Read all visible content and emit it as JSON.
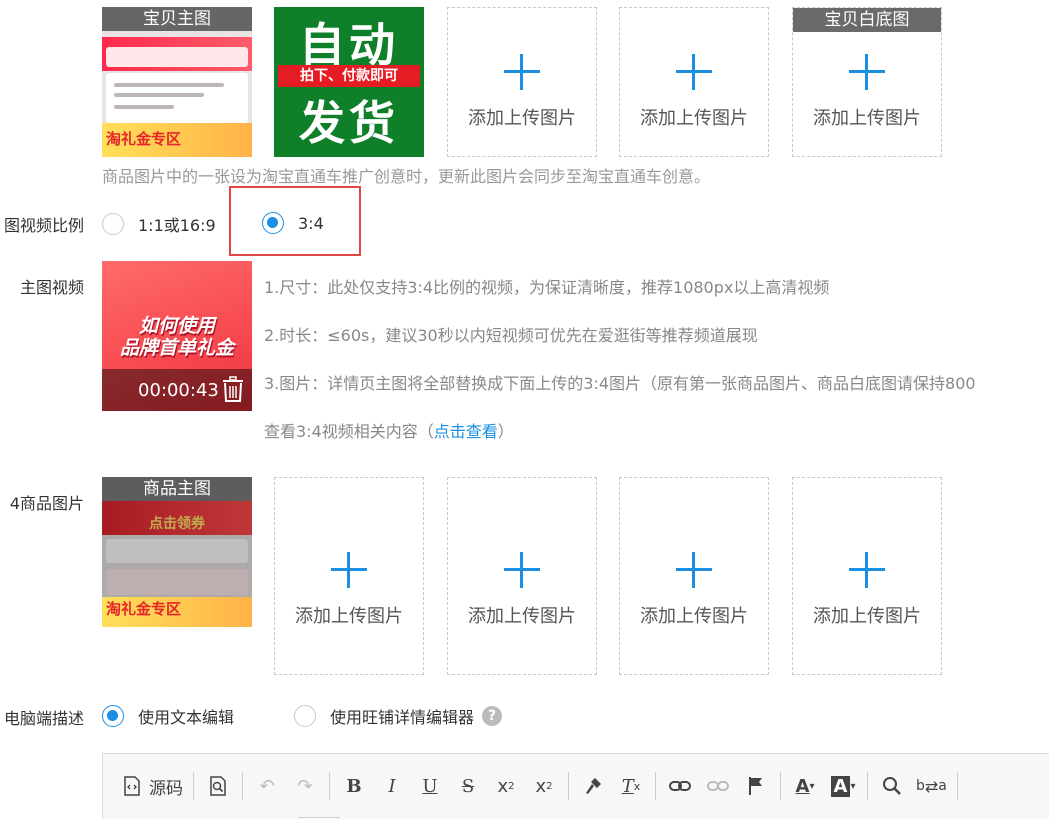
{
  "main_images": {
    "tiles": [
      {
        "tag": "宝贝主图",
        "kind": "product-thumb",
        "banner_text": "淘礼金专区"
      },
      {
        "kind": "auto-ship",
        "line1": "自动",
        "line2": "拍下、付款即可",
        "line3": "发货"
      },
      {
        "kind": "upload",
        "label": "添加上传图片"
      },
      {
        "kind": "upload",
        "label": "添加上传图片"
      },
      {
        "tag": "宝贝白底图",
        "kind": "upload",
        "label": "添加上传图片"
      }
    ],
    "hint": "商品图片中的一张设为淘宝直通车推广创意时，更新此图片会同步至淘宝直通车创意。"
  },
  "ratio": {
    "label": "图视频比例",
    "options": [
      {
        "label": "1:1或16:9",
        "selected": false
      },
      {
        "label": "3:4",
        "selected": true
      }
    ]
  },
  "video": {
    "label": "主图视频",
    "title_line1": "如何使用",
    "title_line2": "品牌首单礼金",
    "duration": "00:00:43",
    "info": [
      "1.尺寸：此处仅支持3:4比例的视频，为保证清晰度，推荐1080px以上高清视频",
      "2.时长：≤60s，建议30秒以内短视频可优先在爱逛街等推荐频道展现",
      "3.图片：详情页主图将全部替换成下面上传的3:4图片（原有第一张商品图片、商品白底图请保持800"
    ],
    "more_prefix": "查看3:4视频相关内容（",
    "more_link": "点击查看",
    "more_suffix": "）"
  },
  "images34": {
    "label": "4商品图片",
    "tiles": [
      {
        "tag": "商品主图",
        "kind": "product-thumb",
        "banner_text": "淘礼金专区",
        "top_text": "点击领券"
      },
      {
        "kind": "upload",
        "label": "添加上传图片"
      },
      {
        "kind": "upload",
        "label": "添加上传图片"
      },
      {
        "kind": "upload",
        "label": "添加上传图片"
      },
      {
        "kind": "upload",
        "label": "添加上传图片"
      }
    ]
  },
  "desc": {
    "label": "电脑端描述",
    "options": [
      {
        "label": "使用文本编辑",
        "selected": true
      },
      {
        "label": "使用旺铺详情编辑器",
        "selected": false
      }
    ],
    "help": "?"
  },
  "toolbar": {
    "source_label": "源码"
  },
  "colors": {
    "accent": "#1a8fe3",
    "highlight": "#e64545"
  }
}
